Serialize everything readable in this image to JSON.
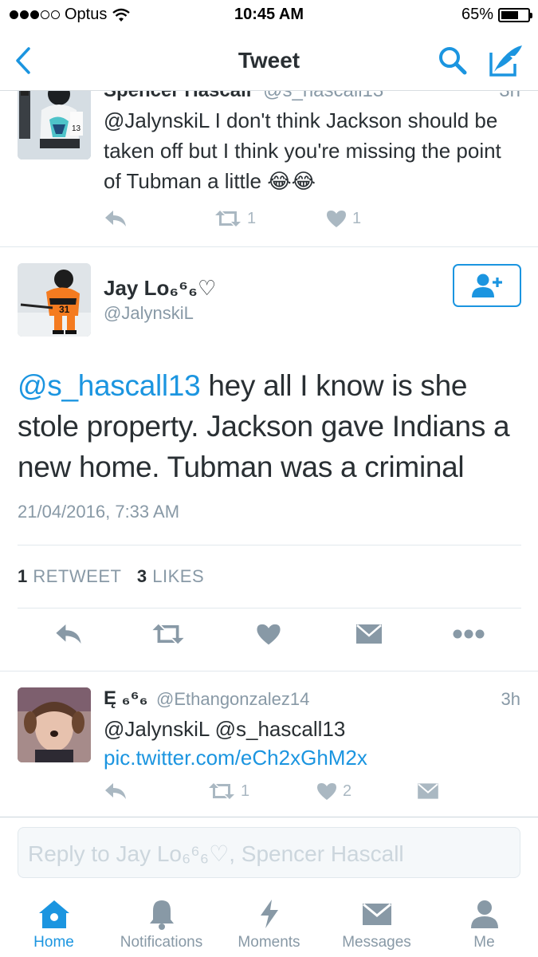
{
  "status_bar": {
    "carrier": "Optus",
    "time": "10:45 AM",
    "battery": "65%",
    "battery_level": 0.65,
    "signal_bars_filled": 3,
    "signal_bars_total": 5
  },
  "nav": {
    "title": "Tweet"
  },
  "tweets": [
    {
      "name": "Spencer Hascall",
      "handle": "@s_hascall13",
      "time": "3h",
      "text": "@JalynskiL I don't think Jackson should be taken off but I think you're missing the point of Tubman a little 😂😂",
      "retweets": "1",
      "likes": "1"
    },
    {
      "name": "Jay Lo₆⁶₆♡",
      "handle": "@JalynskiL",
      "text_mention": "@s_hascall13",
      "text_body": " hey all I know is she stole property. Jackson gave Indians a new home. Tubman was a criminal",
      "date": "21/04/2016, 7:33 AM",
      "retweet_count": "1",
      "retweet_label": "RETWEET",
      "like_count": "3",
      "like_label": "LIKES"
    },
    {
      "name": "Ę ₆⁶₆",
      "handle": "@Ethangonzalez14",
      "time": "3h",
      "text_plain": "@JalynskiL @s_hascall13 ",
      "text_link": "pic.twitter.com/eCh2xGhM2x",
      "retweets": "1",
      "likes": "2"
    }
  ],
  "reply": {
    "placeholder": "Reply to Jay Lo₆⁶₆♡, Spencer Hascall"
  },
  "tabs": [
    {
      "label": "Home",
      "icon": "home-icon",
      "active": true
    },
    {
      "label": "Notifications",
      "icon": "bell-icon",
      "active": false
    },
    {
      "label": "Moments",
      "icon": "lightning-icon",
      "active": false
    },
    {
      "label": "Messages",
      "icon": "envelope-icon",
      "active": false
    },
    {
      "label": "Me",
      "icon": "person-icon",
      "active": false
    }
  ],
  "colors": {
    "accent": "#1b95e0",
    "muted": "#8899a6",
    "icon_muted": "#aab8c2",
    "text": "#292f33"
  }
}
